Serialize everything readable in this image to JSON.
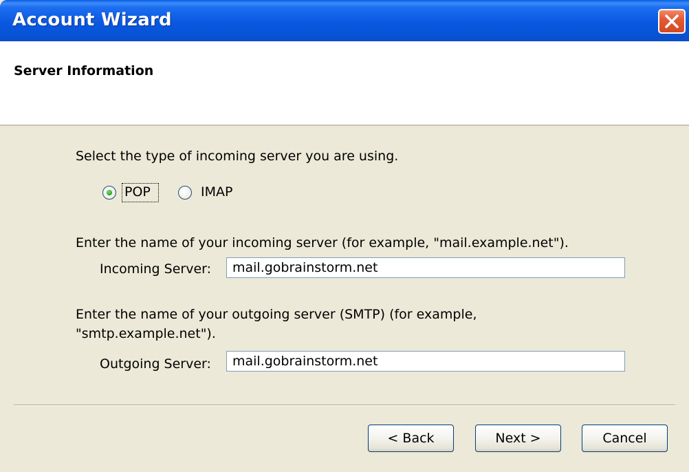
{
  "window": {
    "title": "Account Wizard",
    "close_icon": "close-icon"
  },
  "header": {
    "title": "Server Information"
  },
  "server_type": {
    "prompt": "Select the type of incoming server you are using.",
    "options": [
      {
        "label": "POP",
        "selected": true
      },
      {
        "label": "IMAP",
        "selected": false
      }
    ]
  },
  "incoming": {
    "prompt": "Enter the name of your incoming server (for example, \"mail.example.net\").",
    "label": "Incoming Server:",
    "value": "mail.gobrainstorm.net"
  },
  "outgoing": {
    "prompt_line1": "Enter the name of your outgoing server (SMTP) (for example,",
    "prompt_line2": "\"smtp.example.net\").",
    "label": "Outgoing Server:",
    "value": "mail.gobrainstorm.net"
  },
  "buttons": {
    "back": "< Back",
    "next": "Next >",
    "cancel": "Cancel"
  },
  "colors": {
    "titlebar": "#0a58e0",
    "dialog_background": "#ece9d8",
    "close_button": "#e35a34",
    "radio_selected": "#2ea82e"
  }
}
